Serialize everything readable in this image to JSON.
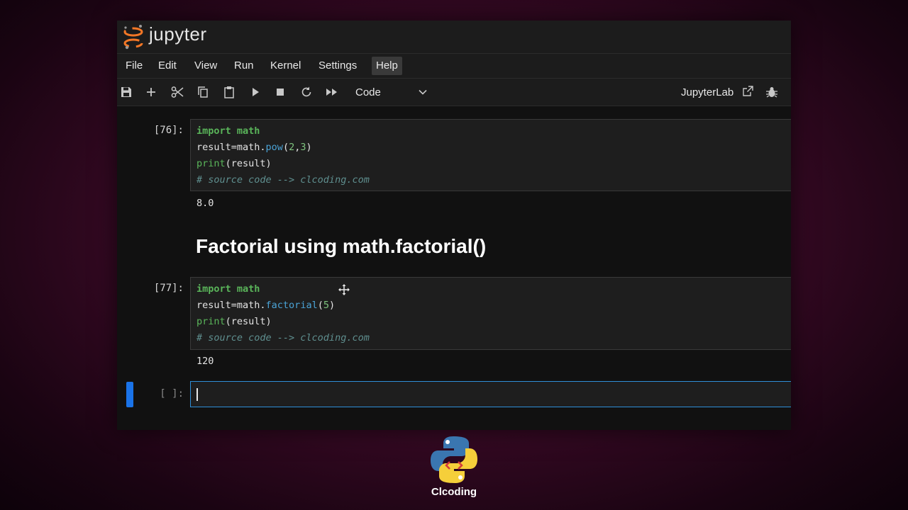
{
  "app": {
    "logo_text": "jupyter",
    "menu": [
      "File",
      "Edit",
      "View",
      "Run",
      "Kernel",
      "Settings",
      "Help"
    ],
    "active_menu": "Help"
  },
  "toolbar": {
    "buttons": [
      "save-icon",
      "add-cell-icon",
      "cut-icon",
      "copy-icon",
      "paste-icon",
      "run-icon",
      "stop-icon",
      "restart-icon",
      "fast-forward-icon"
    ],
    "cell_type": "Code",
    "jupyterlab_label": "JupyterLab"
  },
  "cells": {
    "c1": {
      "prompt": "[76]:",
      "lines": [
        "import math",
        "result=math.pow(2,3)",
        "print(result)",
        "# source code --> clcoding.com"
      ],
      "output": "8.0"
    },
    "heading": "Factorial using math.factorial()",
    "c2": {
      "prompt": "[77]:",
      "lines": [
        "import math",
        "result=math.factorial(5)",
        "print(result)",
        "# source code --> clcoding.com"
      ],
      "output": "120"
    },
    "c3": {
      "prompt": "[ ]:"
    }
  },
  "branding": {
    "name": "Clcoding"
  },
  "colors": {
    "accent": "#1a73e8",
    "keyword": "#5ab55a",
    "function": "#4aa3d6",
    "comment": "#5f8f8f",
    "logo_orange": "#f37726"
  }
}
